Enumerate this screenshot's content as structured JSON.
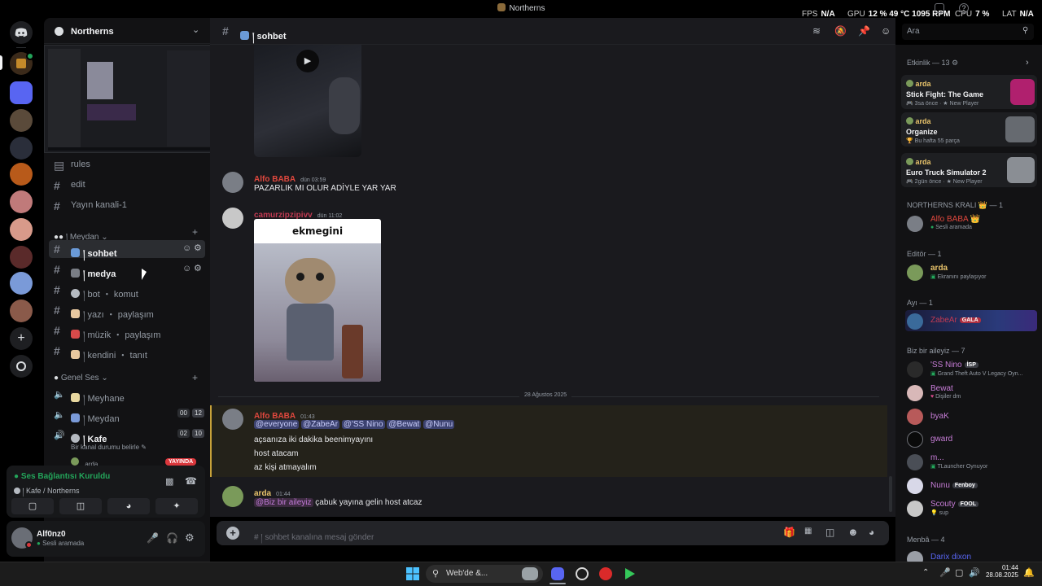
{
  "window": {
    "title": "Northerns"
  },
  "overlay": {
    "fps_label": "FPS",
    "fps_value": "N/A",
    "gpu_label": "GPU",
    "gpu_load": "12 %",
    "gpu_temp": "49 °C",
    "gpu_rpm": "1095 RPM",
    "cpu_label": "CPU",
    "cpu_load": "7 %",
    "lat_label": "LAT",
    "lat_value": "N/A"
  },
  "server": {
    "name": "Northerns"
  },
  "channels": {
    "text_top": [
      {
        "label": "rules"
      },
      {
        "label": "edit"
      },
      {
        "label": "Yayın kanali-1"
      }
    ],
    "meydan_category": "། Meydan",
    "meydan": [
      {
        "label": "། sohbet",
        "selected": true
      },
      {
        "label": "། medya",
        "hovered": true
      },
      {
        "label": "། bot ・ komut"
      },
      {
        "label": "། yazı ・ paylaşım"
      },
      {
        "label": "། müzik ・ paylaşım"
      },
      {
        "label": "། kendini ・ tanıt"
      }
    ],
    "voice_category": "Genel Ses",
    "voice": [
      {
        "label": "། Meyhane"
      },
      {
        "label": "། Meydan",
        "c1": "00",
        "c2": "12"
      },
      {
        "label": "། Kafe",
        "c1": "02",
        "c2": "10",
        "active": true,
        "status_hint": "Bir kanal durumu belirle"
      }
    ],
    "kafe_member": "arda",
    "kafe_member_badge": "YAYINDA"
  },
  "voice_panel": {
    "status": "Ses Bağlantısı Kuruldu",
    "location": "། Kafe / Northerns"
  },
  "user": {
    "name": "Alf0nz0",
    "status": "Sesli aramada"
  },
  "channel_header": {
    "name": "། sohbet",
    "search_placeholder": "Ara"
  },
  "messages": [
    {
      "author": "Alfo BABA",
      "author_color": "#e0483e",
      "time": "dün 03:59",
      "lines": [
        "PAZARLIK MI OLUR ADİYLE YAR YAR"
      ]
    },
    {
      "author": "camurzipzipivv",
      "author_color": "#c23a52",
      "time": "dün 11:02",
      "image_caption": "ekmegini"
    },
    {
      "divider": "28 Ağustos 2025"
    },
    {
      "author": "Alfo BABA",
      "author_color": "#e0483e",
      "time": "01:43",
      "mentions": [
        "@everyone",
        "@ZabeAr",
        "@'SS Nino",
        "@Bewat",
        "@Nunu"
      ],
      "lines": [
        "açsanıza iki dakika beenimyayını",
        "host atacam",
        "az kişi atmayalım"
      ]
    },
    {
      "author": "arda",
      "author_color": "#e8c36b",
      "time": "01:44",
      "role_mention": "@Biz bir aileyiz",
      "text": "çabuk yayına gelin host atcaz"
    }
  ],
  "composer": {
    "placeholder": "# ། sohbet kanalına mesaj gönder"
  },
  "activity": {
    "header": "Etkinlik — 13 ⚙",
    "cards": [
      {
        "user": "arda",
        "game": "Stick Fight: The Game",
        "meta": "3sa önce · ★ New Player",
        "thumb": "#b0206e"
      },
      {
        "user": "arda",
        "game": "Organize",
        "meta": "Bu hafta 55 parça",
        "thumb": "#666a70"
      },
      {
        "user": "arda",
        "game": "Euro Truck Simulator 2",
        "meta": "2gün önce · ★ New Player",
        "thumb": "#8a8e94"
      }
    ]
  },
  "members": {
    "groups": [
      {
        "title": "NORTHERNS KRALI 👑 — 1",
        "items": [
          {
            "name": "Alfo BABA 👑",
            "color": "#e0483e",
            "sub": "Sesli aramada"
          }
        ]
      },
      {
        "title": "Editör — 1",
        "items": [
          {
            "name": "arda",
            "color": "#e8c36b",
            "sub": "Ekranını paylaşıyor"
          }
        ]
      },
      {
        "title": "Ayı — 1",
        "items": [
          {
            "name": "ZabeAr",
            "color": "#c23a52",
            "tag": "GALA",
            "tag_color": "#b03040",
            "highlight": true
          }
        ]
      },
      {
        "title": "Biz bir aileyiz — 7",
        "items": [
          {
            "name": "'SS Nino",
            "color": "#c77dd7",
            "tag": "İSP",
            "tag_color": "#3b3d44",
            "sub": "Grand Theft Auto V Legacy Oyn..."
          },
          {
            "name": "Bewat",
            "color": "#c77dd7",
            "sub": "Dişiler dm"
          },
          {
            "name": "byaK",
            "color": "#c77dd7"
          },
          {
            "name": "gward",
            "color": "#c77dd7"
          },
          {
            "name": "m...",
            "color": "#c77dd7",
            "sub": "TLauncher Oynuyor"
          },
          {
            "name": "Nunu",
            "color": "#c77dd7",
            "tag": "Fenboy",
            "tag_color": "#3b3d44"
          },
          {
            "name": "Scouty",
            "color": "#c77dd7",
            "tag": "FOOL",
            "tag_color": "#3b3d44",
            "sub": "sup"
          }
        ]
      },
      {
        "title": "Menbâ — 4",
        "items": [
          {
            "name": "Darix dixon",
            "color": "#5865f2"
          }
        ]
      }
    ]
  },
  "taskbar": {
    "search_placeholder": "Web'de &...",
    "time": "01:44",
    "date": "28.08.2025"
  }
}
